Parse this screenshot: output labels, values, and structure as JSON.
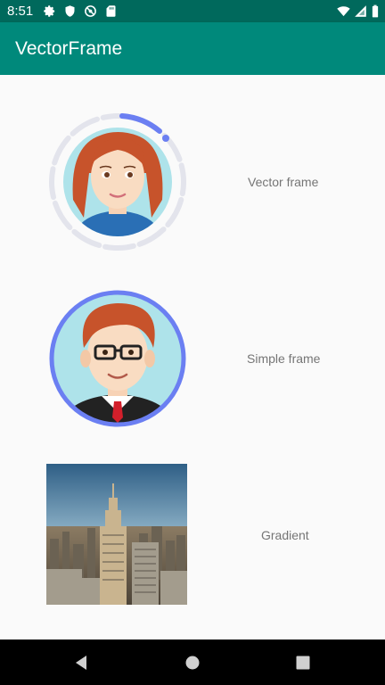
{
  "status_bar": {
    "time": "8:51",
    "icons_left": [
      "gear-icon",
      "shield-icon",
      "no-sync-icon",
      "sd-card-icon"
    ],
    "icons_right": [
      "wifi-icon",
      "signal-icon",
      "battery-icon"
    ]
  },
  "app_bar": {
    "title": "VectorFrame"
  },
  "rows": [
    {
      "label": "Vector frame",
      "image": "woman-avatar",
      "frame": "dashed-ring",
      "accent": "#6b7ff2"
    },
    {
      "label": "Simple frame",
      "image": "man-avatar",
      "frame": "solid-ring",
      "accent": "#6b7ff2"
    },
    {
      "label": "Gradient",
      "image": "city-skyline-photo",
      "frame": "square"
    }
  ],
  "nav_bar": {
    "buttons": [
      "back-icon",
      "home-icon",
      "recents-icon"
    ]
  },
  "colors": {
    "status_bar": "#00695c",
    "app_bar": "#00897b",
    "ring_track": "#e3e4ec",
    "accent": "#6b7ff2"
  }
}
